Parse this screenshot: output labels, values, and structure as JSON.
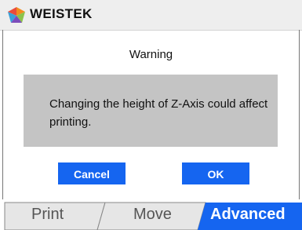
{
  "header": {
    "brand": "WEISTEK",
    "logo_icon": "weistek-logo-icon"
  },
  "dialog": {
    "title": "Warning",
    "message": "Changing the height of Z-Axis could affect printing.",
    "cancel_label": "Cancel",
    "ok_label": "OK"
  },
  "tabs": [
    {
      "label": "Print",
      "active": false
    },
    {
      "label": "Move",
      "active": false
    },
    {
      "label": "Advanced",
      "active": true
    }
  ],
  "colors": {
    "accent": "#1565f0",
    "message_bg": "#c4c4c4",
    "header_bg": "#eeeeee",
    "inactive_tab": "#e6e6e6"
  }
}
